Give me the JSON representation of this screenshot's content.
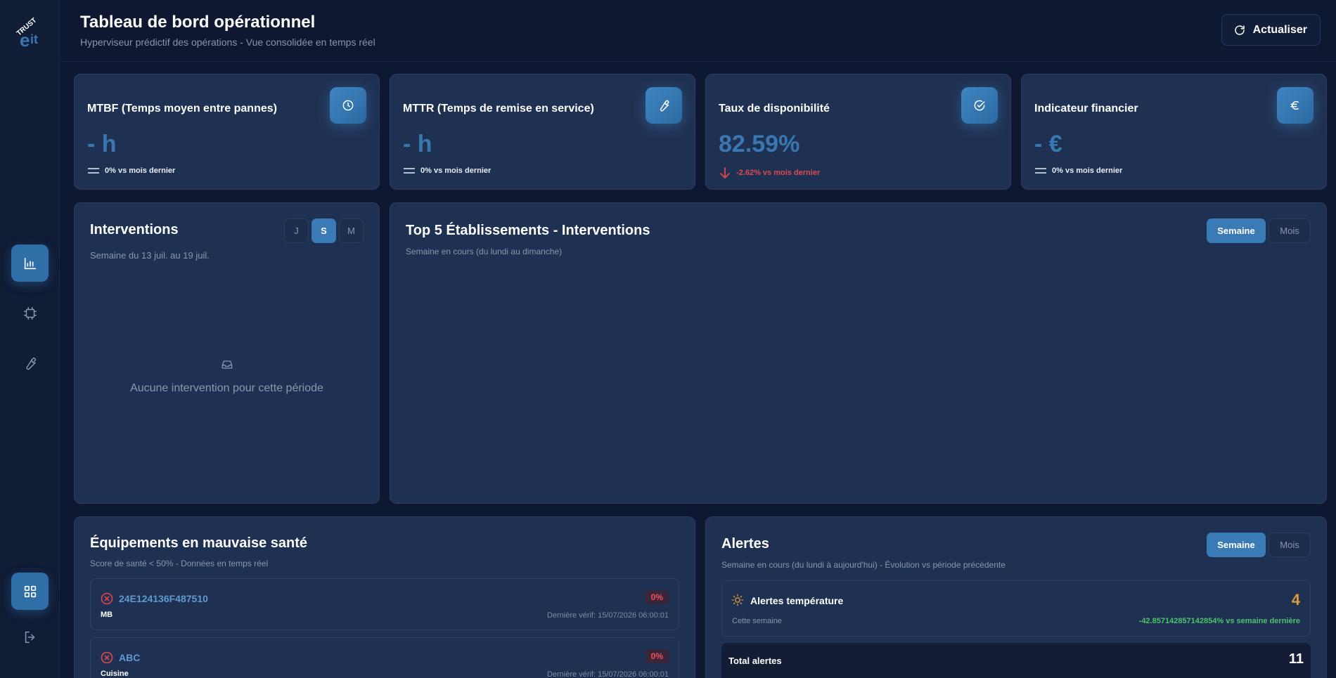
{
  "app": {
    "logo_text": "TRUST eit"
  },
  "header": {
    "title": "Tableau de bord opérationnel",
    "subtitle": "Hyperviseur prédictif des opérations - Vue consolidée en temps réel",
    "refresh_label": "Actualiser"
  },
  "sidebar": {
    "items": [
      {
        "name": "dashboard",
        "icon": "bar-chart-icon",
        "active": true
      },
      {
        "name": "equipments",
        "icon": "chip-icon",
        "active": false
      },
      {
        "name": "maintenance",
        "icon": "wrench-icon",
        "active": false
      }
    ],
    "bottom": [
      {
        "name": "apps",
        "icon": "grid-icon",
        "active": true
      },
      {
        "name": "logout",
        "icon": "logout-icon",
        "active": false
      }
    ]
  },
  "kpis": [
    {
      "title": "MTBF (Temps moyen entre pannes)",
      "value": "- h",
      "delta": "0% vs mois dernier",
      "trend": "flat",
      "icon": "clock-icon"
    },
    {
      "title": "MTTR (Temps de remise en service)",
      "value": "- h",
      "delta": "0% vs mois dernier",
      "trend": "flat",
      "icon": "wrench-icon"
    },
    {
      "title": "Taux de disponibilité",
      "value": "82.59%",
      "delta": "-2.62% vs mois dernier",
      "trend": "down",
      "icon": "check-circle-icon"
    },
    {
      "title": "Indicateur financier",
      "value": "- €",
      "delta": "0% vs mois dernier",
      "trend": "flat",
      "icon": "euro-icon"
    }
  ],
  "interventions": {
    "title": "Interventions",
    "period": "Semaine du 13 juil. au 19 juil.",
    "toggles": [
      "J",
      "S",
      "M"
    ],
    "active_toggle": "S",
    "empty_text": "Aucune intervention pour cette période"
  },
  "top5": {
    "title": "Top 5 Établissements - Interventions",
    "subtitle": "Semaine en cours (du lundi au dimanche)",
    "toggles": [
      "Semaine",
      "Mois"
    ],
    "active_toggle": "Semaine"
  },
  "equipments": {
    "title": "Équipements en mauvaise santé",
    "subtitle": "Score de santé < 50% - Données en temps réel",
    "items": [
      {
        "id": "24E124136F487510",
        "location": "MB",
        "score": "0%",
        "last_check": "Dernière vérif: 15/07/2026 06:00:01"
      },
      {
        "id": "ABC",
        "location": "Cuisine",
        "score": "0%",
        "last_check": "Dernière vérif: 15/07/2026 06:00:01"
      }
    ]
  },
  "alerts": {
    "title": "Alertes",
    "subtitle": "Semaine en cours (du lundi à aujourd'hui) - Évolution vs période précédente",
    "toggles": [
      "Semaine",
      "Mois"
    ],
    "active_toggle": "Semaine",
    "temperature": {
      "label": "Alertes température",
      "count": "4",
      "period": "Cette semaine",
      "delta": "-42.857142857142854% vs semaine dernière"
    },
    "total": {
      "label": "Total alertes",
      "count": "11"
    }
  },
  "colors": {
    "accent": "#3a7ab5",
    "background": "#0e1830",
    "card": "#1f3152",
    "negative": "#e2474f",
    "positive": "#4cc36b",
    "warning": "#d99a3a"
  }
}
